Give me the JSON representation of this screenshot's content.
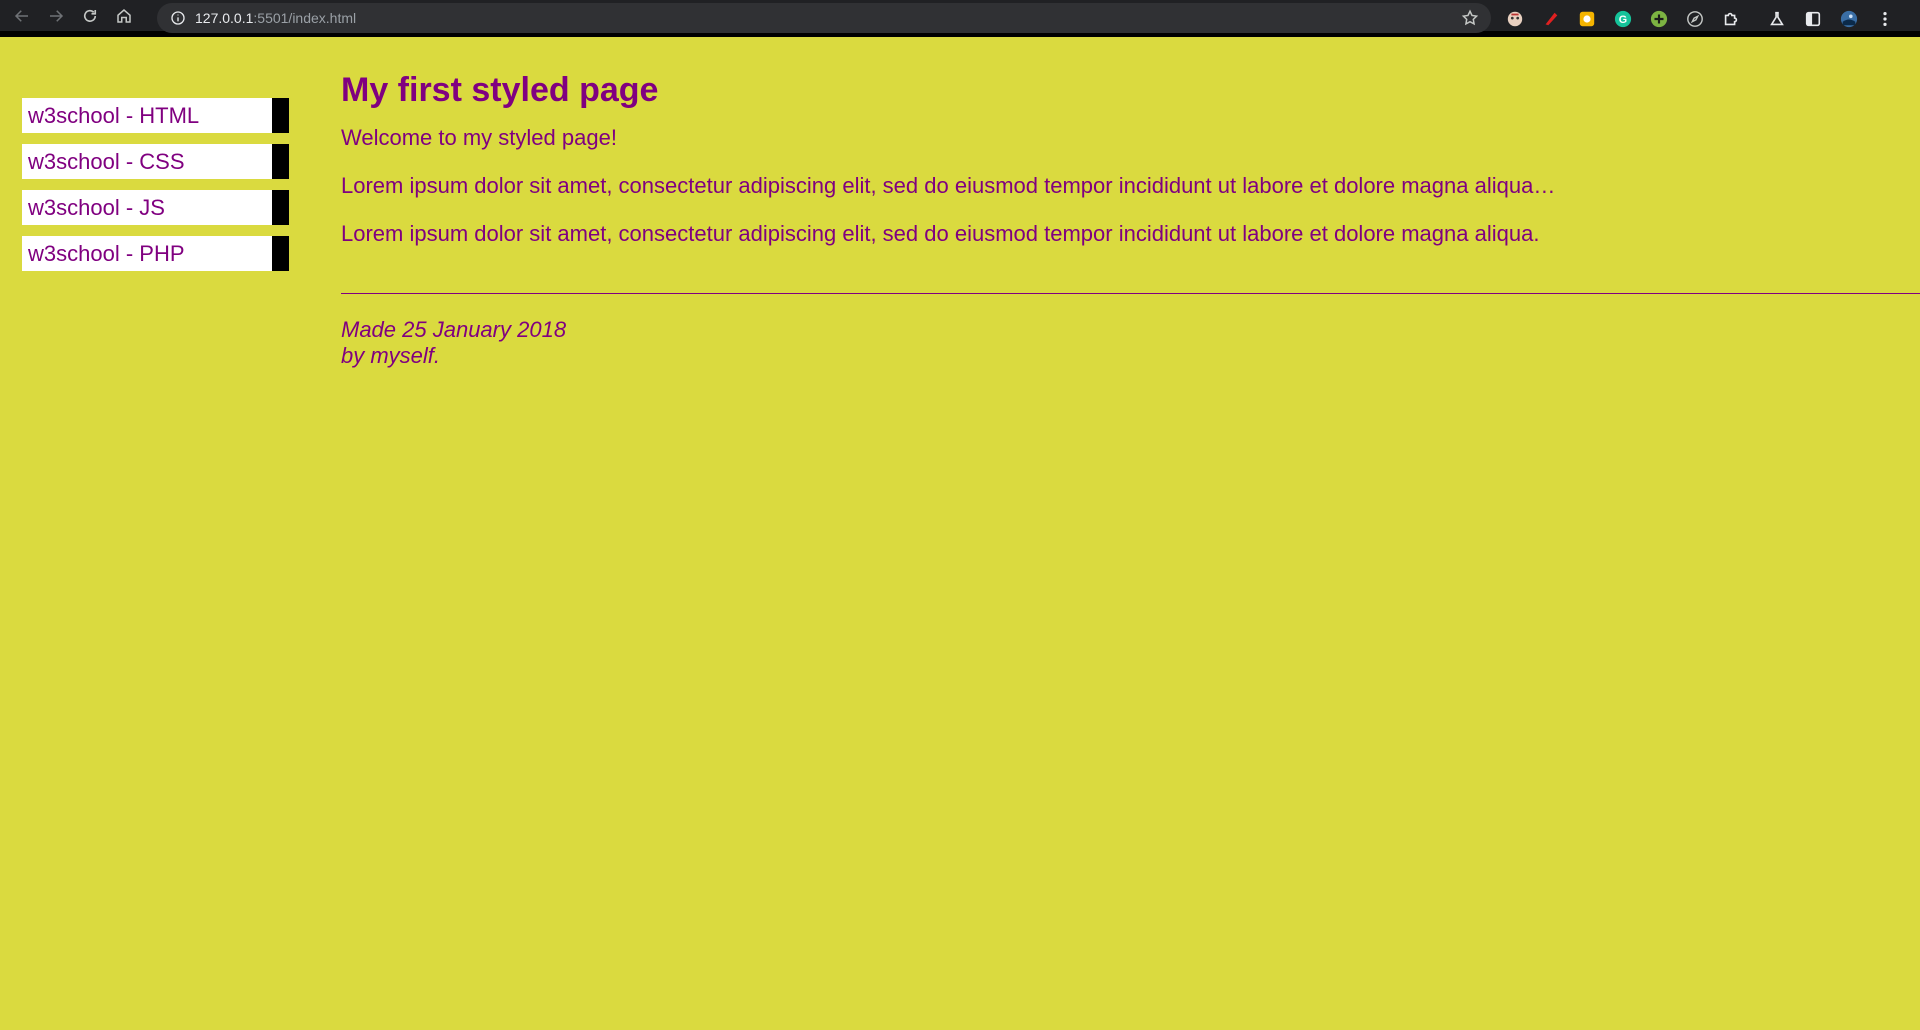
{
  "browser": {
    "url_host": "127.0.0.1",
    "url_path": ":5501/index.html",
    "icons": [
      "back-icon",
      "forward-icon",
      "reload-icon",
      "home-icon",
      "info-icon",
      "star-icon"
    ],
    "extensions": [
      "ext-face-icon",
      "ext-red-icon",
      "ext-yellow-icon",
      "ext-grammarly-icon",
      "ext-green-plus-icon",
      "ext-compass-icon",
      "extensions-puzzle-icon",
      "labs-flask-icon",
      "side-panel-icon",
      "profile-avatar-icon",
      "menu-kebab-icon"
    ]
  },
  "sidebar": {
    "items": [
      {
        "label": "w3school - HTML"
      },
      {
        "label": "w3school - CSS"
      },
      {
        "label": "w3school - JS"
      },
      {
        "label": "w3school - PHP"
      }
    ]
  },
  "main": {
    "title": "My first styled page",
    "welcome": "Welcome to my styled page!",
    "paragraph1": "Lorem ipsum dolor sit amet, consectetur adipiscing elit, sed do eiusmod tempor incididunt ut labore et dolore magna aliqua…",
    "paragraph2": "Lorem ipsum dolor sit amet, consectetur adipiscing elit, sed do eiusmod tempor incididunt ut labore et dolore magna aliqua.",
    "footer_line1": "Made 25 January 2018",
    "footer_line2": "by myself."
  },
  "colors": {
    "background": "#dada3f",
    "text": "#800080",
    "nav_bg": "#ffffff",
    "nav_bar": "#000000"
  }
}
